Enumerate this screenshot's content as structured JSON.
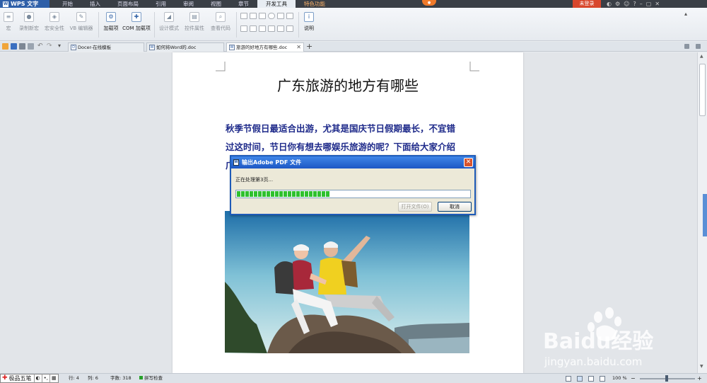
{
  "menubar": {
    "app_name": "WPS 文字",
    "tabs": [
      "开始",
      "插入",
      "页面布局",
      "引用",
      "审阅",
      "视图",
      "章节",
      "开发工具",
      "特色功能"
    ],
    "active_tab": "开发工具",
    "login_label": "未登录"
  },
  "ribbon": {
    "buttons": [
      "宏",
      "录制新宏",
      "宏安全性",
      "VB 编辑器",
      "加载项",
      "COM 加载项",
      "设计模式",
      "控件属性",
      "查看代码",
      "说明"
    ]
  },
  "tabs": [
    {
      "label": "Docer-在线模板",
      "active": false
    },
    {
      "label": "如何将Word的.doc",
      "active": false
    },
    {
      "label": "旅游的好地方有哪些.doc",
      "active": true
    }
  ],
  "document": {
    "title": "广东旅游的地方有哪些",
    "line1": "秋季节假日最适合出游，尤其是国庆节日假期最长，不宜错",
    "line2": "过这时间，节日你有想去哪娱乐旅游的呢？下面给大家介绍",
    "line3_visible": "广"
  },
  "dialog": {
    "title": "输出Adobe PDF 文件",
    "status": "正在处理第3页...",
    "progress": 0.4,
    "open_file_label": "打开文件(O)",
    "cancel_label": "取消"
  },
  "statusbar": {
    "ime_name": "极品五笔",
    "row_label": "行: 4",
    "col_label": "列: 6",
    "word_count_label": "字数: 318",
    "spell_check_label": "拼写检查",
    "zoom_label": "100 %"
  },
  "watermark": {
    "brand": "Baidu经验",
    "url": "jingyan.baidu.com"
  },
  "colors": {
    "accent": "#2e5fa8",
    "doc_text": "#1e2a8a",
    "progress": "#2ec02e",
    "dialog_title": "#1d57c4"
  }
}
